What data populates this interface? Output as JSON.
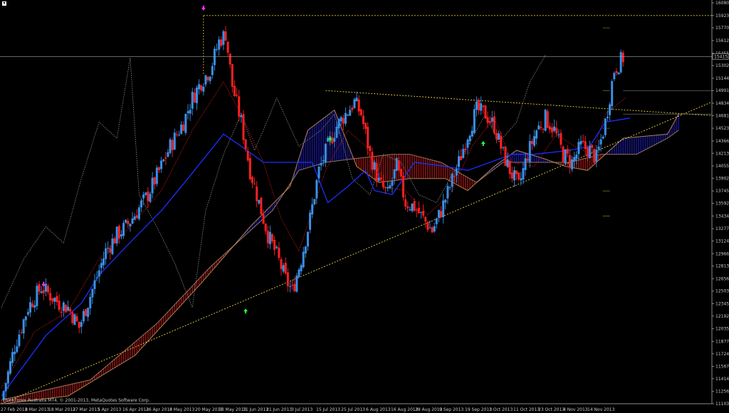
{
  "window": {
    "copyright": "ThinkForex Australia MT4, © 2001-2013, MetaQuotes Software Corp."
  },
  "colors": {
    "background": "#000000",
    "bull_candle": "#3a8fe8",
    "bear_candle": "#ff2020",
    "tenkan": "#d01818",
    "kijun": "#1a30ff",
    "chikou": "#8c8c8c",
    "span_a": "#b08050",
    "span_b": "#d0a080",
    "kumo_bull": "#1a1aa0",
    "kumo_bear": "#a01818",
    "trendline": "#e8d040",
    "fractal_up": "#20ff40",
    "fractal_down": "#ff30ff",
    "price_line": "#a0a0a0"
  },
  "chart_data": {
    "type": "candlestick",
    "indicators": [
      "Ichimoku Kinko Hyo",
      "Fractals"
    ],
    "ylim": [
      11103.5,
      16080.5
    ],
    "price_ticks": [
      "16080.5",
      "15923.0",
      "15770.0",
      "15612.5",
      "15455.0",
      "15302.0",
      "15144.5",
      "14991.5",
      "14834.0",
      "14681.0",
      "14523.5",
      "14366.0",
      "14213.0",
      "14055.5",
      "13902.5",
      "13745.0",
      "13592.0",
      "13434.5",
      "13277.0",
      "13124.0",
      "12966.5",
      "12813.5",
      "12656.0",
      "12503.0",
      "12345.5",
      "12192.5",
      "12035.0",
      "11877.5",
      "11724.5",
      "11567.0",
      "11414.5",
      "11256.5",
      "11103.5"
    ],
    "current_price": "15415.0",
    "resistance_level": "15923.0",
    "date_ticks": [
      "27 Feb 2013",
      "8 Mar 2013",
      "18 Mar 2013",
      "27 Mar 2013",
      "5 Apr 2013",
      "16 Apr 2013",
      "26 Apr 2013",
      "8 May 2013",
      "20 May 2013",
      "30 May 2013",
      "11 Jun 2013",
      "21 Jun 2013",
      "3 Jul 2013",
      "15 Jul 2013",
      "25 Jul 2013",
      "6 Aug 2013",
      "16 Aug 2013",
      "28 Aug 2013",
      "9 Sep 2013",
      "19 Sep 2013",
      "1 Oct 2013",
      "11 Oct 2013",
      "23 Oct 2013",
      "4 Nov 2013",
      "14 Nov 2013"
    ],
    "close_path": [
      [
        0,
        11150
      ],
      [
        6,
        11820
      ],
      [
        12,
        12300
      ],
      [
        18,
        12550
      ],
      [
        26,
        12350
      ],
      [
        30,
        12300
      ],
      [
        35,
        12050
      ],
      [
        42,
        12600
      ],
      [
        47,
        13000
      ],
      [
        52,
        13200
      ],
      [
        56,
        13300
      ],
      [
        60,
        13450
      ],
      [
        66,
        13700
      ],
      [
        72,
        14050
      ],
      [
        76,
        14300
      ],
      [
        82,
        14600
      ],
      [
        86,
        14900
      ],
      [
        90,
        15100
      ],
      [
        94,
        15250
      ],
      [
        98,
        15600
      ],
      [
        101,
        15700
      ],
      [
        104,
        15050
      ],
      [
        108,
        14600
      ],
      [
        112,
        14000
      ],
      [
        116,
        13600
      ],
      [
        120,
        13200
      ],
      [
        124,
        12950
      ],
      [
        128,
        12650
      ],
      [
        131,
        12500
      ],
      [
        135,
        12900
      ],
      [
        139,
        13400
      ],
      [
        143,
        14000
      ],
      [
        147,
        14300
      ],
      [
        151,
        14550
      ],
      [
        155,
        14700
      ],
      [
        159,
        14850
      ],
      [
        162,
        14700
      ],
      [
        166,
        14200
      ],
      [
        170,
        13850
      ],
      [
        174,
        13700
      ],
      [
        178,
        14050
      ],
      [
        182,
        13600
      ],
      [
        186,
        13550
      ],
      [
        190,
        13400
      ],
      [
        194,
        13250
      ],
      [
        198,
        13500
      ],
      [
        202,
        13800
      ],
      [
        206,
        14100
      ],
      [
        210,
        14450
      ],
      [
        214,
        14750
      ],
      [
        218,
        14700
      ],
      [
        222,
        14550
      ],
      [
        226,
        14200
      ],
      [
        229,
        14000
      ],
      [
        233,
        13800
      ],
      [
        237,
        14200
      ],
      [
        241,
        14500
      ],
      [
        245,
        14650
      ],
      [
        249,
        14500
      ],
      [
        253,
        14200
      ],
      [
        257,
        14100
      ],
      [
        261,
        14300
      ],
      [
        265,
        14250
      ],
      [
        268,
        14150
      ],
      [
        272,
        14600
      ],
      [
        276,
        15250
      ],
      [
        280,
        15400
      ]
    ],
    "ichimoku_paths": {
      "kijun": [
        [
          0,
          11200
        ],
        [
          20,
          11950
        ],
        [
          36,
          12350
        ],
        [
          44,
          12700
        ],
        [
          56,
          13050
        ],
        [
          72,
          13500
        ],
        [
          84,
          13900
        ],
        [
          100,
          14450
        ],
        [
          108,
          14300
        ],
        [
          118,
          14100
        ],
        [
          130,
          14100
        ],
        [
          140,
          14100
        ],
        [
          147,
          13600
        ],
        [
          156,
          13800
        ],
        [
          164,
          14000
        ],
        [
          168,
          13750
        ],
        [
          176,
          13700
        ],
        [
          186,
          14100
        ],
        [
          200,
          14050
        ],
        [
          210,
          14000
        ],
        [
          230,
          14200
        ],
        [
          240,
          14200
        ],
        [
          256,
          14250
        ],
        [
          265,
          14300
        ],
        [
          272,
          14600
        ],
        [
          283,
          14650
        ]
      ],
      "tenkan": [
        [
          0,
          11300
        ],
        [
          15,
          12000
        ],
        [
          30,
          12250
        ],
        [
          44,
          12900
        ],
        [
          58,
          13300
        ],
        [
          72,
          13750
        ],
        [
          86,
          14500
        ],
        [
          100,
          15100
        ],
        [
          108,
          14700
        ],
        [
          118,
          14100
        ],
        [
          126,
          13400
        ],
        [
          134,
          13000
        ],
        [
          146,
          14000
        ],
        [
          156,
          14500
        ],
        [
          164,
          14300
        ],
        [
          172,
          13800
        ],
        [
          182,
          13750
        ],
        [
          192,
          13450
        ],
        [
          202,
          13700
        ],
        [
          212,
          14300
        ],
        [
          222,
          14650
        ],
        [
          230,
          14100
        ],
        [
          240,
          14050
        ],
        [
          250,
          14450
        ],
        [
          258,
          14300
        ],
        [
          266,
          14200
        ],
        [
          272,
          14700
        ],
        [
          281,
          14900
        ]
      ],
      "chikou": [
        [
          0,
          12300
        ],
        [
          10,
          12900
        ],
        [
          20,
          13300
        ],
        [
          28,
          13100
        ],
        [
          36,
          13900
        ],
        [
          44,
          14600
        ],
        [
          52,
          14400
        ],
        [
          58,
          15400
        ],
        [
          62,
          13700
        ],
        [
          70,
          13300
        ],
        [
          78,
          12850
        ],
        [
          86,
          12300
        ],
        [
          92,
          13500
        ],
        [
          100,
          14200
        ],
        [
          108,
          14700
        ],
        [
          114,
          14250
        ],
        [
          118,
          14500
        ],
        [
          124,
          14900
        ],
        [
          134,
          14300
        ],
        [
          144,
          14500
        ],
        [
          150,
          14700
        ],
        [
          158,
          13900
        ],
        [
          166,
          13700
        ],
        [
          172,
          14200
        ],
        [
          180,
          14100
        ],
        [
          188,
          13700
        ],
        [
          196,
          13600
        ],
        [
          204,
          14000
        ],
        [
          212,
          14400
        ],
        [
          218,
          14700
        ],
        [
          224,
          14350
        ],
        [
          232,
          14600
        ],
        [
          238,
          15100
        ],
        [
          245,
          15430
        ]
      ],
      "span_a": [
        [
          0,
          11100
        ],
        [
          30,
          11200
        ],
        [
          60,
          11700
        ],
        [
          90,
          12600
        ],
        [
          112,
          13300
        ],
        [
          130,
          13800
        ],
        [
          138,
          14500
        ],
        [
          150,
          14750
        ],
        [
          160,
          14050
        ],
        [
          170,
          13850
        ],
        [
          184,
          13900
        ],
        [
          200,
          13900
        ],
        [
          210,
          13750
        ],
        [
          222,
          14050
        ],
        [
          232,
          14250
        ],
        [
          244,
          14150
        ],
        [
          254,
          14050
        ],
        [
          264,
          14000
        ],
        [
          280,
          14400
        ],
        [
          300,
          14450
        ],
        [
          305,
          14700
        ]
      ],
      "span_b": [
        [
          0,
          11150
        ],
        [
          40,
          11400
        ],
        [
          70,
          12100
        ],
        [
          94,
          12800
        ],
        [
          110,
          13200
        ],
        [
          122,
          13500
        ],
        [
          134,
          14000
        ],
        [
          146,
          14100
        ],
        [
          160,
          14150
        ],
        [
          176,
          14200
        ],
        [
          184,
          14200
        ],
        [
          198,
          14100
        ],
        [
          214,
          13850
        ],
        [
          226,
          14100
        ],
        [
          240,
          14100
        ],
        [
          256,
          14100
        ],
        [
          270,
          14200
        ],
        [
          286,
          14200
        ],
        [
          300,
          14400
        ],
        [
          305,
          14500
        ]
      ]
    },
    "trendlines": [
      {
        "name": "ascending support",
        "from": [
          0,
          11103.5
        ],
        "to": [
          320,
          14850
        ]
      },
      {
        "name": "descending resistance",
        "from": [
          146,
          14991.5
        ],
        "to": [
          320,
          14681
        ]
      }
    ],
    "fractals_up": [
      [
        110,
        12250
      ],
      [
        148,
        14380
      ],
      [
        217,
        14330
      ]
    ],
    "fractals_down": [
      [
        19,
        12590
      ],
      [
        91,
        16020
      ]
    ]
  }
}
